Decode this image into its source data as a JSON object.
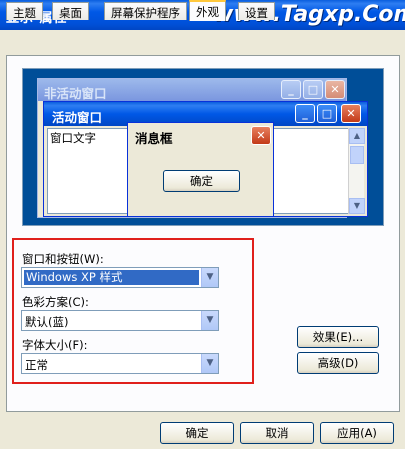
{
  "window": {
    "title": "显示 属性",
    "watermark": "www.Tagxp.Com"
  },
  "tabs": [
    {
      "label": "主题"
    },
    {
      "label": "桌面"
    },
    {
      "label": "屏幕保护程序"
    },
    {
      "label": "外观",
      "active": true
    },
    {
      "label": "设置"
    }
  ],
  "preview": {
    "inactive_title": "非活动窗口",
    "active_title": "活动窗口",
    "window_text": "窗口文字",
    "msgbox_title": "消息框",
    "msgbox_ok": "确定"
  },
  "caption_buttons": {
    "minimize": "_",
    "maximize": "□",
    "close": "✕"
  },
  "settings": {
    "windows_buttons_label": "窗口和按钮(W):",
    "windows_buttons_value": "Windows XP 样式",
    "color_scheme_label": "色彩方案(C):",
    "color_scheme_value": "默认(蓝)",
    "font_size_label": "字体大小(F):",
    "font_size_value": "正常"
  },
  "side_buttons": {
    "effects": "效果(E)...",
    "advanced": "高级(D)"
  },
  "footer": {
    "ok": "确定",
    "cancel": "取消",
    "apply": "应用(A)"
  },
  "colors": {
    "titlebar": "#0058e6",
    "highlight_frame": "#e0201c",
    "preview_desktop": "#004e98",
    "selection": "#316ac5"
  }
}
